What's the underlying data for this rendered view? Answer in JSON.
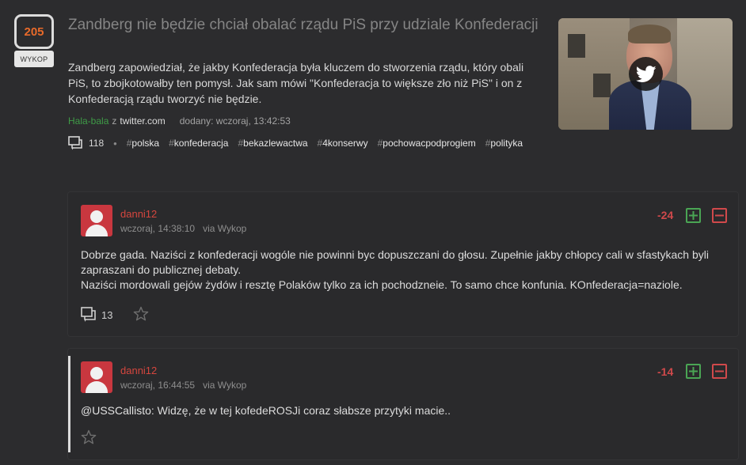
{
  "link": {
    "votes": "205",
    "vote_button": "WYKOP",
    "title": "Zandberg nie będzie chciał obalać rządu PiS przy udziale Konfederacji",
    "description": "Zandberg zapowiedział, że jakby Konfederacja była kluczem do stworzenia rządu, który obali PiS, to zbojkotowałby ten pomysł. Jak sam mówi \"Konfederacja to większe zło niż PiS\" i on z Konfederacją rządu tworzyć nie będzie.",
    "author": "Hala-bala",
    "from_label": "z",
    "domain": "twitter.com",
    "added": "dodany: wczoraj, 13:42:53",
    "comments_count": "118",
    "tags": [
      "polska",
      "konfederacja",
      "bekazlewactwa",
      "4konserwy",
      "pochowacpodprogiem",
      "polityka"
    ],
    "thumbnail_icon": "twitter-icon"
  },
  "comments": [
    {
      "author": "danni12",
      "time": "wczoraj, 14:38:10",
      "via": "via Wykop",
      "score": "-24",
      "body": "Dobrze gada. Naziści z konfederacji wogóle nie powinni byc dopuszczani do głosu. Zupełnie jakby chłopcy cali w sfastykach byli zapraszani do publicznej debaty.\nNaziści mordowali gejów żydów i resztę Polaków tylko za ich pochodzneie. To samo chce konfunia. KOnfederacja=naziole.",
      "replies": "13"
    },
    {
      "author": "danni12",
      "time": "wczoraj, 16:44:55",
      "via": "via Wykop",
      "score": "-14",
      "mention": "@USSCallisto",
      "body": ": Widzę, że w tej kofedeROSJi coraz słabsze przytyki macie.."
    }
  ],
  "colors": {
    "background": "#2c2c2e",
    "votes": "#e86a2a",
    "author_link": "#3f9c47",
    "comment_author": "#d5463e",
    "negative_score": "#d0494b",
    "plus": "#4aa554"
  }
}
